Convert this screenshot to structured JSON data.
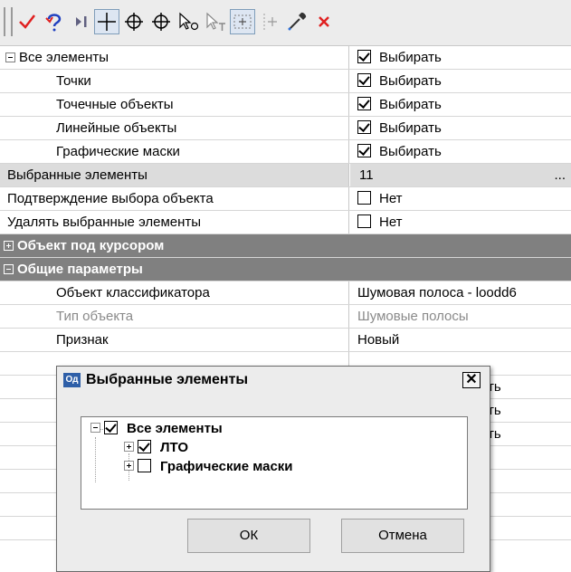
{
  "toolbar": {
    "icons": [
      "checkmark-icon",
      "undo-selection-icon",
      "next-icon",
      "crosshair-icon",
      "circle-crosshair-icon",
      "circle-crosshair-alt-icon",
      "pointer-o-icon",
      "pointer-t-icon",
      "select-frame-icon",
      "snap-line-icon",
      "eyedropper-icon",
      "delete-icon"
    ],
    "colors": {
      "check": "#e02020",
      "undo": "#2040c0",
      "delete": "#e02020"
    }
  },
  "grid": {
    "rows": [
      {
        "name": "Все элементы",
        "value": "Выбирать",
        "checked": true,
        "expandable": true
      },
      {
        "name": "Точки",
        "value": "Выбирать",
        "checked": true
      },
      {
        "name": "Точечные объекты",
        "value": "Выбирать",
        "checked": true
      },
      {
        "name": "Линейные объекты",
        "value": "Выбирать",
        "checked": true
      },
      {
        "name": "Графические маски",
        "value": "Выбирать",
        "checked": true
      },
      {
        "name": "Выбранные элементы",
        "value": "11",
        "dots": "..."
      },
      {
        "name": "Подтверждение выбора объекта",
        "value": "Нет",
        "checked": false
      },
      {
        "name": "Удалять выбранные элементы",
        "value": "Нет",
        "checked": false
      }
    ],
    "categories": {
      "cursor_object": "Объект под курсором",
      "general": "Общие параметры"
    },
    "general_rows": [
      {
        "name": "Объект классификатора",
        "value": "Шумовая полоса - loodd6"
      },
      {
        "name": "Тип объекта",
        "value": "Шумовые полосы"
      },
      {
        "name": "Признак",
        "value": "Новый"
      }
    ],
    "peek_fragments": [
      "ть",
      "ть",
      "ть"
    ]
  },
  "dialog": {
    "icon_text": "Од",
    "title": "Выбранные элементы",
    "close": "✕",
    "tree": {
      "root": "Все элементы",
      "child1": "ЛТО",
      "child2": "Графические маски"
    },
    "ok": "ОК",
    "cancel": "Отмена"
  }
}
